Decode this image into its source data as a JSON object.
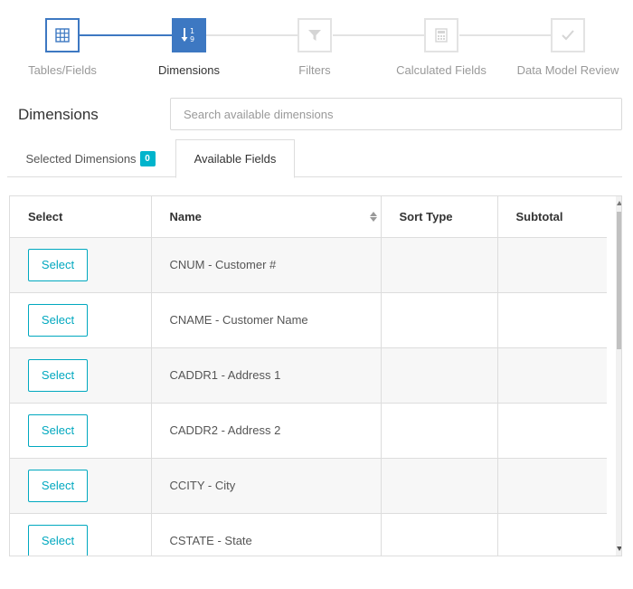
{
  "stepper": {
    "steps": [
      {
        "label": "Tables/Fields",
        "state": "done",
        "icon": "grid-icon"
      },
      {
        "label": "Dimensions",
        "state": "current",
        "icon": "sort-numeric-icon"
      },
      {
        "label": "Filters",
        "state": "pending",
        "icon": "filter-icon"
      },
      {
        "label": "Calculated Fields",
        "state": "pending",
        "icon": "calculator-icon"
      },
      {
        "label": "Data Model Review",
        "state": "pending",
        "icon": "check-icon"
      }
    ],
    "active_color": "#3d78c2",
    "inactive_color": "#e3e3e3"
  },
  "section": {
    "title": "Dimensions"
  },
  "search": {
    "placeholder": "Search available dimensions",
    "value": ""
  },
  "tabs": [
    {
      "label": "Selected Dimensions",
      "badge": "0",
      "active": false
    },
    {
      "label": "Available Fields",
      "active": true
    }
  ],
  "table": {
    "columns": [
      "Select",
      "Name",
      "Sort Type",
      "Subtotal"
    ],
    "rows": [
      {
        "button": "Select",
        "name": "CNUM - Customer #",
        "sort_type": "",
        "subtotal": ""
      },
      {
        "button": "Select",
        "name": "CNAME - Customer Name",
        "sort_type": "",
        "subtotal": ""
      },
      {
        "button": "Select",
        "name": "CADDR1 - Address 1",
        "sort_type": "",
        "subtotal": ""
      },
      {
        "button": "Select",
        "name": "CADDR2 - Address 2",
        "sort_type": "",
        "subtotal": ""
      },
      {
        "button": "Select",
        "name": "CCITY - City",
        "sort_type": "",
        "subtotal": ""
      },
      {
        "button": "Select",
        "name": "CSTATE - State",
        "sort_type": "",
        "subtotal": ""
      }
    ]
  },
  "colors": {
    "accent": "#00a8bf",
    "badge": "#00b4cc"
  }
}
